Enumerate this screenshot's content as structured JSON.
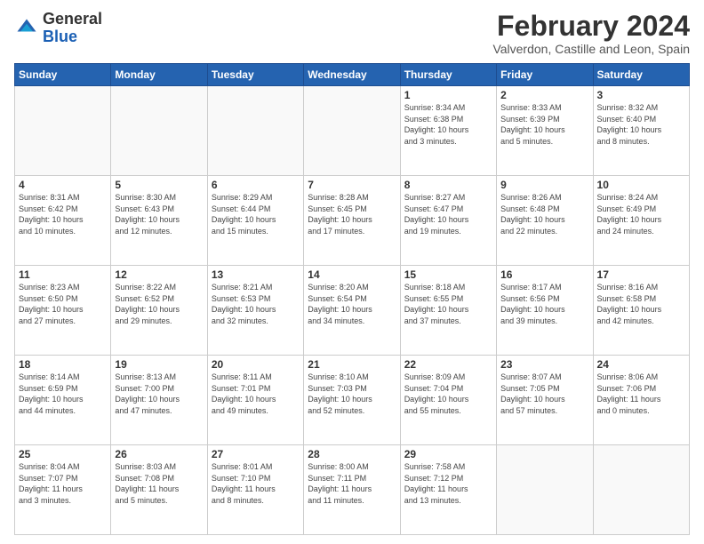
{
  "logo": {
    "general": "General",
    "blue": "Blue"
  },
  "header": {
    "month": "February 2024",
    "location": "Valverdon, Castille and Leon, Spain"
  },
  "weekdays": [
    "Sunday",
    "Monday",
    "Tuesday",
    "Wednesday",
    "Thursday",
    "Friday",
    "Saturday"
  ],
  "weeks": [
    [
      {
        "day": "",
        "info": ""
      },
      {
        "day": "",
        "info": ""
      },
      {
        "day": "",
        "info": ""
      },
      {
        "day": "",
        "info": ""
      },
      {
        "day": "1",
        "info": "Sunrise: 8:34 AM\nSunset: 6:38 PM\nDaylight: 10 hours\nand 3 minutes."
      },
      {
        "day": "2",
        "info": "Sunrise: 8:33 AM\nSunset: 6:39 PM\nDaylight: 10 hours\nand 5 minutes."
      },
      {
        "day": "3",
        "info": "Sunrise: 8:32 AM\nSunset: 6:40 PM\nDaylight: 10 hours\nand 8 minutes."
      }
    ],
    [
      {
        "day": "4",
        "info": "Sunrise: 8:31 AM\nSunset: 6:42 PM\nDaylight: 10 hours\nand 10 minutes."
      },
      {
        "day": "5",
        "info": "Sunrise: 8:30 AM\nSunset: 6:43 PM\nDaylight: 10 hours\nand 12 minutes."
      },
      {
        "day": "6",
        "info": "Sunrise: 8:29 AM\nSunset: 6:44 PM\nDaylight: 10 hours\nand 15 minutes."
      },
      {
        "day": "7",
        "info": "Sunrise: 8:28 AM\nSunset: 6:45 PM\nDaylight: 10 hours\nand 17 minutes."
      },
      {
        "day": "8",
        "info": "Sunrise: 8:27 AM\nSunset: 6:47 PM\nDaylight: 10 hours\nand 19 minutes."
      },
      {
        "day": "9",
        "info": "Sunrise: 8:26 AM\nSunset: 6:48 PM\nDaylight: 10 hours\nand 22 minutes."
      },
      {
        "day": "10",
        "info": "Sunrise: 8:24 AM\nSunset: 6:49 PM\nDaylight: 10 hours\nand 24 minutes."
      }
    ],
    [
      {
        "day": "11",
        "info": "Sunrise: 8:23 AM\nSunset: 6:50 PM\nDaylight: 10 hours\nand 27 minutes."
      },
      {
        "day": "12",
        "info": "Sunrise: 8:22 AM\nSunset: 6:52 PM\nDaylight: 10 hours\nand 29 minutes."
      },
      {
        "day": "13",
        "info": "Sunrise: 8:21 AM\nSunset: 6:53 PM\nDaylight: 10 hours\nand 32 minutes."
      },
      {
        "day": "14",
        "info": "Sunrise: 8:20 AM\nSunset: 6:54 PM\nDaylight: 10 hours\nand 34 minutes."
      },
      {
        "day": "15",
        "info": "Sunrise: 8:18 AM\nSunset: 6:55 PM\nDaylight: 10 hours\nand 37 minutes."
      },
      {
        "day": "16",
        "info": "Sunrise: 8:17 AM\nSunset: 6:56 PM\nDaylight: 10 hours\nand 39 minutes."
      },
      {
        "day": "17",
        "info": "Sunrise: 8:16 AM\nSunset: 6:58 PM\nDaylight: 10 hours\nand 42 minutes."
      }
    ],
    [
      {
        "day": "18",
        "info": "Sunrise: 8:14 AM\nSunset: 6:59 PM\nDaylight: 10 hours\nand 44 minutes."
      },
      {
        "day": "19",
        "info": "Sunrise: 8:13 AM\nSunset: 7:00 PM\nDaylight: 10 hours\nand 47 minutes."
      },
      {
        "day": "20",
        "info": "Sunrise: 8:11 AM\nSunset: 7:01 PM\nDaylight: 10 hours\nand 49 minutes."
      },
      {
        "day": "21",
        "info": "Sunrise: 8:10 AM\nSunset: 7:03 PM\nDaylight: 10 hours\nand 52 minutes."
      },
      {
        "day": "22",
        "info": "Sunrise: 8:09 AM\nSunset: 7:04 PM\nDaylight: 10 hours\nand 55 minutes."
      },
      {
        "day": "23",
        "info": "Sunrise: 8:07 AM\nSunset: 7:05 PM\nDaylight: 10 hours\nand 57 minutes."
      },
      {
        "day": "24",
        "info": "Sunrise: 8:06 AM\nSunset: 7:06 PM\nDaylight: 11 hours\nand 0 minutes."
      }
    ],
    [
      {
        "day": "25",
        "info": "Sunrise: 8:04 AM\nSunset: 7:07 PM\nDaylight: 11 hours\nand 3 minutes."
      },
      {
        "day": "26",
        "info": "Sunrise: 8:03 AM\nSunset: 7:08 PM\nDaylight: 11 hours\nand 5 minutes."
      },
      {
        "day": "27",
        "info": "Sunrise: 8:01 AM\nSunset: 7:10 PM\nDaylight: 11 hours\nand 8 minutes."
      },
      {
        "day": "28",
        "info": "Sunrise: 8:00 AM\nSunset: 7:11 PM\nDaylight: 11 hours\nand 11 minutes."
      },
      {
        "day": "29",
        "info": "Sunrise: 7:58 AM\nSunset: 7:12 PM\nDaylight: 11 hours\nand 13 minutes."
      },
      {
        "day": "",
        "info": ""
      },
      {
        "day": "",
        "info": ""
      }
    ]
  ]
}
